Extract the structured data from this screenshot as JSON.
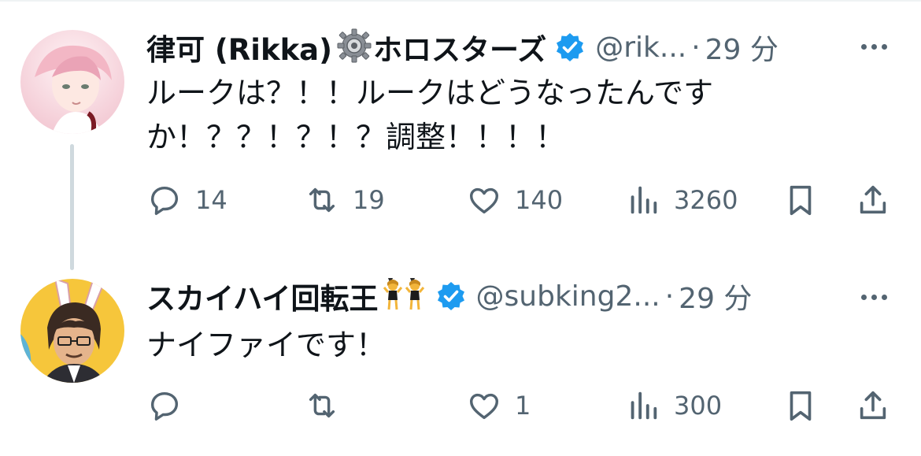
{
  "tweets": [
    {
      "name": "律可 (Rikka)",
      "name_suffix": "ホロスターズ",
      "handle": "@rik...",
      "dot": "·",
      "time": "29 分",
      "text_line1": "ルークは？！！ルークはどうなったんです",
      "text_line2": "か！？？！？！？調整！！！！",
      "replies": "14",
      "retweets": "19",
      "likes": "140",
      "views": "3260",
      "avatar_colors": [
        "#f6d7de",
        "#e9b9c4",
        "#ffffff"
      ]
    },
    {
      "name": "スカイハイ回転王",
      "name_emoji": "👯",
      "handle": "@subking2...",
      "dot": "·",
      "time": "29 分",
      "text_line1": "ナイファイです！",
      "replies": "",
      "retweets": "",
      "likes": "1",
      "views": "300",
      "avatar_colors": [
        "#f6c63b",
        "#3a2a22",
        "#ffffff"
      ]
    }
  ],
  "icons": {
    "verified": "verified-badge-icon",
    "gear": "gear-icon",
    "reply": "reply-icon",
    "retweet": "retweet-icon",
    "like": "heart-icon",
    "views": "views-chart-icon",
    "bookmark": "bookmark-icon",
    "share": "share-icon",
    "more": "more-icon"
  },
  "colors": {
    "accent": "#1d9bf0",
    "text": "#0f1419",
    "secondary": "#536471",
    "thread_line": "#cfd9de"
  }
}
